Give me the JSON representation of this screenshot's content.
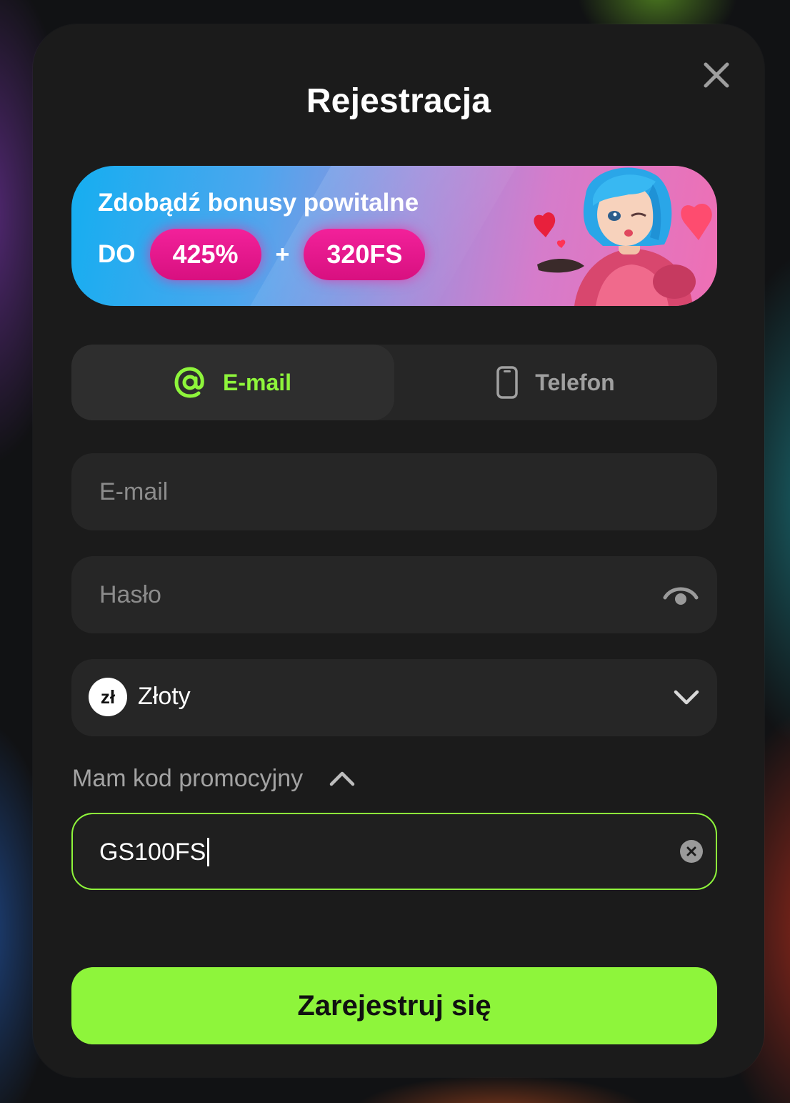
{
  "modal": {
    "title": "Rejestracja"
  },
  "banner": {
    "heading": "Zdobądź bonusy powitalne",
    "prefix": "DO",
    "bonus_percent": "425%",
    "plus": "+",
    "free_spins": "320FS"
  },
  "tabs": [
    {
      "label": "E-mail",
      "icon": "at-icon",
      "active": true
    },
    {
      "label": "Telefon",
      "icon": "phone-icon",
      "active": false
    }
  ],
  "form": {
    "email_placeholder": "E-mail",
    "email_value": "",
    "password_placeholder": "Hasło",
    "password_value": "",
    "currency": {
      "symbol": "zł",
      "label": "Złoty"
    },
    "promo_toggle_label": "Mam kod promocyjny",
    "promo_value": "GS100FS",
    "submit_label": "Zarejestruj się"
  },
  "colors": {
    "accent": "#8ef53b",
    "modal_bg": "#1b1b1b",
    "field_bg": "#262626",
    "pill": "#e8188e"
  }
}
